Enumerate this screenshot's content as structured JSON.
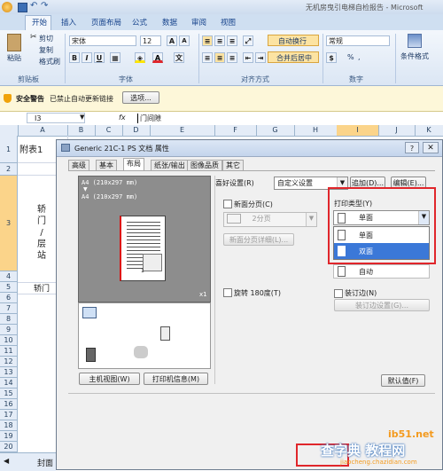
{
  "app": {
    "title": "无机房曳引电梯自检报告 - Microsoft",
    "tabs": [
      "开始",
      "插入",
      "页面布局",
      "公式",
      "数据",
      "审阅",
      "视图"
    ],
    "active_tab": "开始"
  },
  "ribbon": {
    "clipboard": {
      "paste": "粘贴",
      "cut": "剪切",
      "copy": "复制",
      "format_painter": "格式刷",
      "group": "剪贴板"
    },
    "font": {
      "name": "宋体",
      "size": "12",
      "group": "字体"
    },
    "alignment": {
      "wrap": "自动换行",
      "merge": "合并后居中",
      "group": "对齐方式"
    },
    "number": {
      "format": "常规",
      "percent": "%",
      "comma": ",",
      "group": "数字"
    },
    "styles": {
      "conditional": "条件格式"
    }
  },
  "security_bar": {
    "title": "安全警告",
    "message": "已禁止自动更新链接",
    "options": "选项..."
  },
  "formula_bar": {
    "cell_ref": "I3",
    "fx": "fx",
    "content": "门间隙"
  },
  "sheet": {
    "columns": [
      "A",
      "B",
      "C",
      "D",
      "E",
      "F",
      "G",
      "H",
      "I",
      "J",
      "K"
    ],
    "rows": [
      "1",
      "2",
      "3",
      "4",
      "5",
      "6",
      "7",
      "8",
      "9",
      "10",
      "11",
      "12",
      "13",
      "14",
      "15",
      "16",
      "17",
      "18",
      "19",
      "20"
    ],
    "a1": "附表1",
    "a3": "轿\n门\n/\n层\n站",
    "a5": "轿门",
    "sheet_tab": "封面"
  },
  "dialog": {
    "title": "Generic 21C-1 PS 文档 属性",
    "tabs": [
      "高级",
      "基本",
      "布局",
      "纸张/输出",
      "图像品质",
      "其它"
    ],
    "active_tab": "布局",
    "preview_line1": "A4 (210x297 mm)",
    "preview_arrow": "▼",
    "preview_line2": "A4 (210x297 mm)",
    "preview_copies": "x1",
    "printer_view_button": "主机视图(W)",
    "printer_info_button": "打印机信息(M)",
    "favorites_label": "喜好设置(R)",
    "favorites_value": "自定义设置",
    "add_button": "追加(D)...",
    "edit_button": "编辑(E)...",
    "new_page_label": "新面分页(C)",
    "pages_value": "2分页",
    "new_page_detail_button": "新面分页详细(L)...",
    "rotate_label": "旋转 180度(T)",
    "print_type_label": "打印类型(Y)",
    "print_type_value": "单面",
    "print_type_options": [
      "单面",
      "双面"
    ],
    "print_type_selected": "双面",
    "auto_value": "自动",
    "binding_label": "装订边(N)",
    "binding_settings_button": "装订边设置(G)...",
    "default_button": "默认值(F)"
  },
  "watermark": {
    "text1": "查字典 教程网",
    "text2": "jiaocheng.chazidian.com",
    "site": "ib51.net"
  },
  "colors": {
    "highlight_red": "#e0262b",
    "select_blue": "#3b78d8",
    "ribbon_blue": "#cfdff1"
  }
}
